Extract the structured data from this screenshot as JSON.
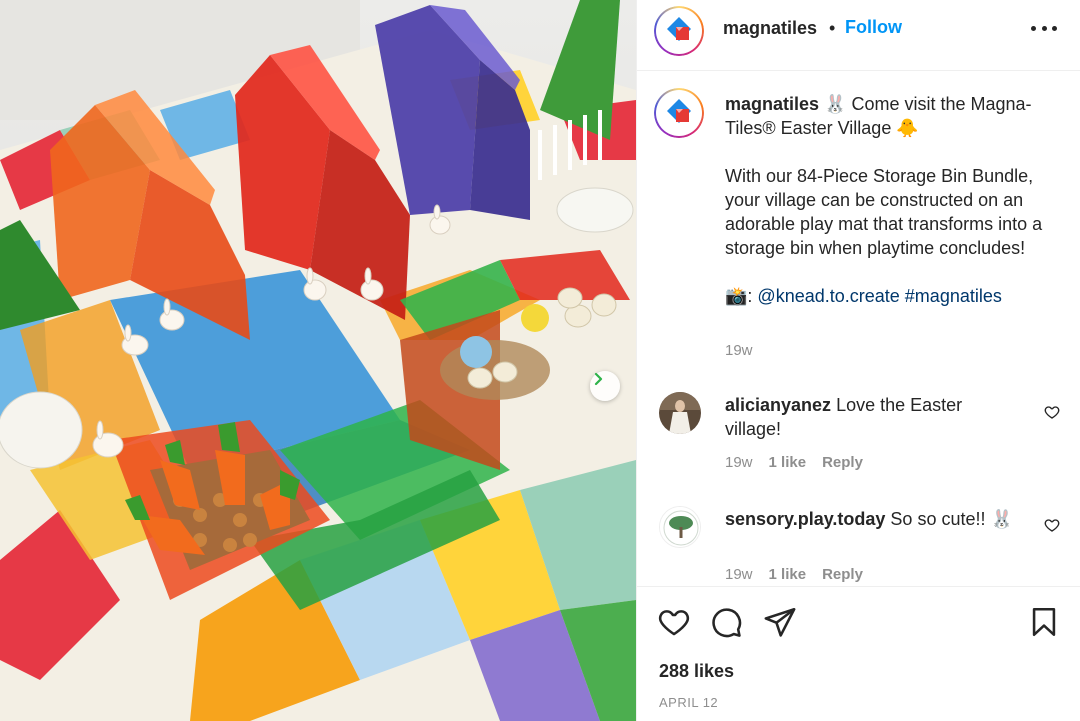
{
  "post": {
    "username": "magnatiles",
    "separator": "•",
    "follow_label": "Follow",
    "more_icon": "more-horizontal-icon",
    "photo_alt": "Magna-Tiles Easter village photo",
    "next_icon": "chevron-right-icon"
  },
  "caption": {
    "username": "magnatiles",
    "line1": "🐰 Come visit the Magna-Tiles® Easter Village 🐥",
    "line2": "With our 84-Piece Storage Bin Bundle, your village can be constructed on an adorable play mat that transforms into a storage bin when playtime concludes!",
    "line3_prefix": "📸: ",
    "mention": "@knead.to.create",
    "hashtag": "#magnatiles",
    "time": "19w"
  },
  "comments": [
    {
      "username": "alicianyanez",
      "text": "Love the Easter village!",
      "time": "19w",
      "likes": "1 like",
      "reply": "Reply"
    },
    {
      "username": "sensory.play.today",
      "text": "So so cute!! 🐰",
      "time": "19w",
      "likes": "1 like",
      "reply": "Reply"
    }
  ],
  "actions": {
    "icons": [
      "heart-icon",
      "comment-icon",
      "share-icon",
      "bookmark-icon"
    ],
    "likes": "288 likes",
    "date": "APRIL 12"
  },
  "colors": {
    "follow": "#0095f6",
    "link": "#00376b",
    "muted": "#8e8e8e"
  }
}
